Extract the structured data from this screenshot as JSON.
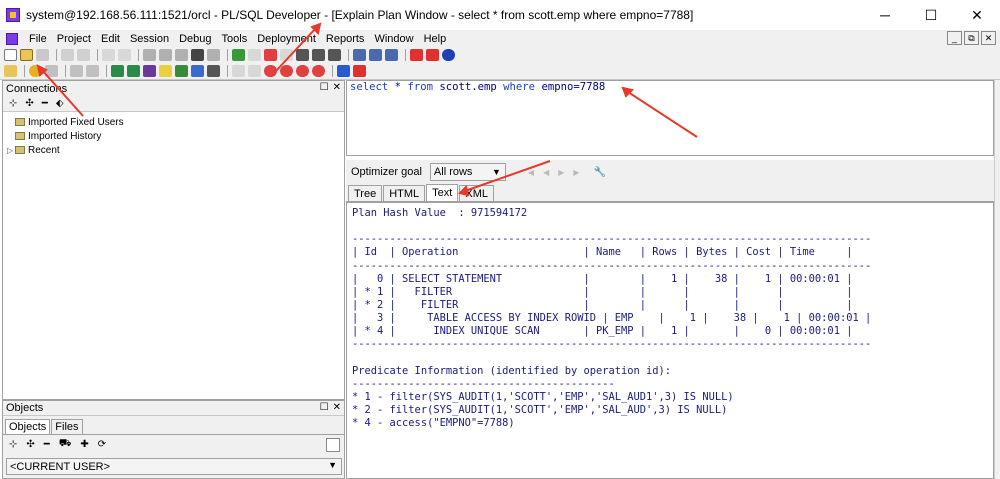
{
  "window": {
    "title": "system@192.168.56.111:1521/orcl - PL/SQL Developer - [Explain Plan Window - select * from scott.emp where empno=7788]",
    "minimize": "─",
    "maximize": "☐",
    "close": "✕"
  },
  "menu": {
    "items": [
      "File",
      "Project",
      "Edit",
      "Session",
      "Debug",
      "Tools",
      "Deployment",
      "Reports",
      "Window",
      "Help"
    ],
    "mdi": [
      "_",
      "⧉",
      "✕"
    ]
  },
  "connections": {
    "title": "Connections",
    "head_buttons": [
      "☐",
      "✕"
    ],
    "tools": [
      "⊹",
      "✣",
      "━",
      "⬖"
    ],
    "tree": [
      {
        "label": "Imported Fixed Users",
        "expander": ""
      },
      {
        "label": "Imported History",
        "expander": ""
      },
      {
        "label": "Recent",
        "expander": "▷"
      }
    ]
  },
  "objects": {
    "title": "Objects",
    "head_buttons": [
      "☐",
      "✕"
    ],
    "tabs": [
      "Objects",
      "Files"
    ],
    "tools": [
      "⊹",
      "✣",
      "━",
      "⛟",
      "✚",
      "⟳"
    ],
    "user_select": "<CURRENT USER>"
  },
  "editor": {
    "sql": "select * from scott.emp where empno=7788"
  },
  "optimizer": {
    "label": "Optimizer goal",
    "value": "All rows",
    "nav": [
      "◀",
      "◀",
      "▶",
      "▶"
    ],
    "wrench": "🔧"
  },
  "plan_tabs": [
    "Tree",
    "HTML",
    "Text",
    "XML"
  ],
  "plan_text": [
    "Plan Hash Value  : 971594172",
    "",
    "-----------------------------------------------------------------------------------",
    "| Id  | Operation                    | Name   | Rows | Bytes | Cost | Time     |",
    "-----------------------------------------------------------------------------------",
    "|   0 | SELECT STATEMENT             |        |    1 |    38 |    1 | 00:00:01 |",
    "| * 1 |   FILTER                     |        |      |       |      |          |",
    "| * 2 |    FILTER                    |        |      |       |      |          |",
    "|   3 |     TABLE ACCESS BY INDEX ROWID | EMP    |    1 |    38 |    1 | 00:00:01 |",
    "| * 4 |      INDEX UNIQUE SCAN       | PK_EMP |    1 |       |    0 | 00:00:01 |",
    "-----------------------------------------------------------------------------------",
    "",
    "Predicate Information (identified by operation id):",
    "------------------------------------------",
    "* 1 - filter(SYS_AUDIT(1,'SCOTT','EMP','SAL_AUD1',3) IS NULL)",
    "* 2 - filter(SYS_AUDIT(1,'SCOTT','EMP','SAL_AUD',3) IS NULL)",
    "* 4 - access(\"EMPNO\"=7788)"
  ],
  "colors": {
    "annotation_arrow": "#e8392a",
    "plan_text": "#1a1a80",
    "sql_keyword": "#1f3fb8"
  }
}
